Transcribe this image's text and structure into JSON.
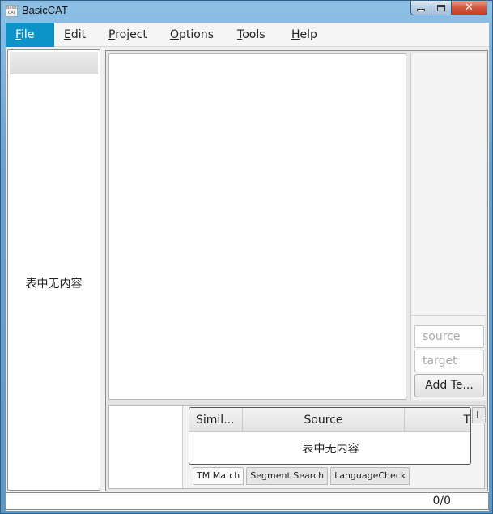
{
  "window": {
    "title": "BasicCAT",
    "icon_text": "Basic CAT"
  },
  "menubar": {
    "items": [
      {
        "label": "File",
        "mnemonic": "F",
        "rest": "ile",
        "active": true
      },
      {
        "label": "Edit",
        "mnemonic": "E",
        "rest": "dit"
      },
      {
        "label": "Project",
        "mnemonic": "P",
        "rest": "roject"
      },
      {
        "label": "Options",
        "mnemonic": "O",
        "rest": "ptions"
      },
      {
        "label": "Tools",
        "mnemonic": "T",
        "rest": "ools"
      },
      {
        "label": "Help",
        "mnemonic": "H",
        "rest": "elp"
      }
    ]
  },
  "segment_table": {
    "empty_text": "表中无内容"
  },
  "term_panel": {
    "source_placeholder": "source",
    "target_placeholder": "target",
    "add_button_label": "Add Te..."
  },
  "tm_table": {
    "columns": [
      "Simil...",
      "Source",
      "T"
    ],
    "empty_text": "表中无内容",
    "corner_button": "L"
  },
  "bottom_tabs": [
    {
      "label": "TM Match",
      "selected": true
    },
    {
      "label": "Segment Search"
    },
    {
      "label": "LanguageCheck"
    }
  ],
  "statusbar": {
    "segment_count": "0/0"
  },
  "colors": {
    "menu_active_bg": "#0e93c9",
    "close_button": "#c3402a"
  }
}
